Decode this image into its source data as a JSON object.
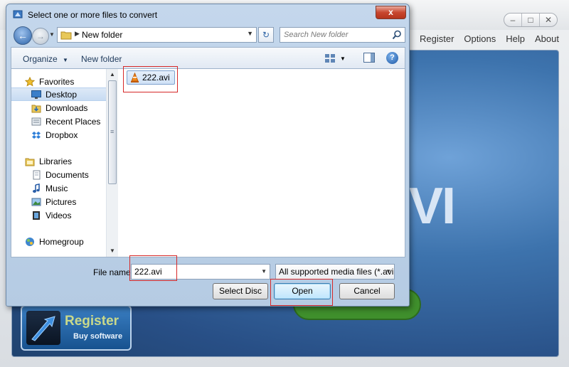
{
  "background_app": {
    "menu": [
      "Register",
      "Options",
      "Help",
      "About"
    ],
    "window_controls": [
      "minimize",
      "maximize",
      "close"
    ],
    "logo_fragment": "VI",
    "register_card": {
      "title": "Register",
      "subtitle": "Buy software"
    }
  },
  "dialog": {
    "title": "Select one or more files to convert",
    "close_glyph": "x",
    "address": {
      "path": "New folder"
    },
    "search": {
      "placeholder": "Search New folder"
    },
    "toolbar": {
      "organize": "Organize",
      "new_folder": "New folder"
    },
    "nav": {
      "favorites_header": "Favorites",
      "favorites": [
        "Desktop",
        "Downloads",
        "Recent Places",
        "Dropbox"
      ],
      "libraries_header": "Libraries",
      "libraries": [
        "Documents",
        "Music",
        "Pictures",
        "Videos"
      ],
      "homegroup": "Homegroup",
      "selected": "Desktop"
    },
    "files": [
      {
        "name": "222.avi",
        "icon": "vlc-cone-icon",
        "selected": true
      }
    ],
    "file_name": {
      "label": "File name:",
      "value": "222.avi"
    },
    "file_type": {
      "selected": "All supported media files (*.avi"
    },
    "buttons": {
      "select_disc": "Select Disc",
      "open": "Open",
      "cancel": "Cancel"
    },
    "highlight_color": "#d62828"
  }
}
